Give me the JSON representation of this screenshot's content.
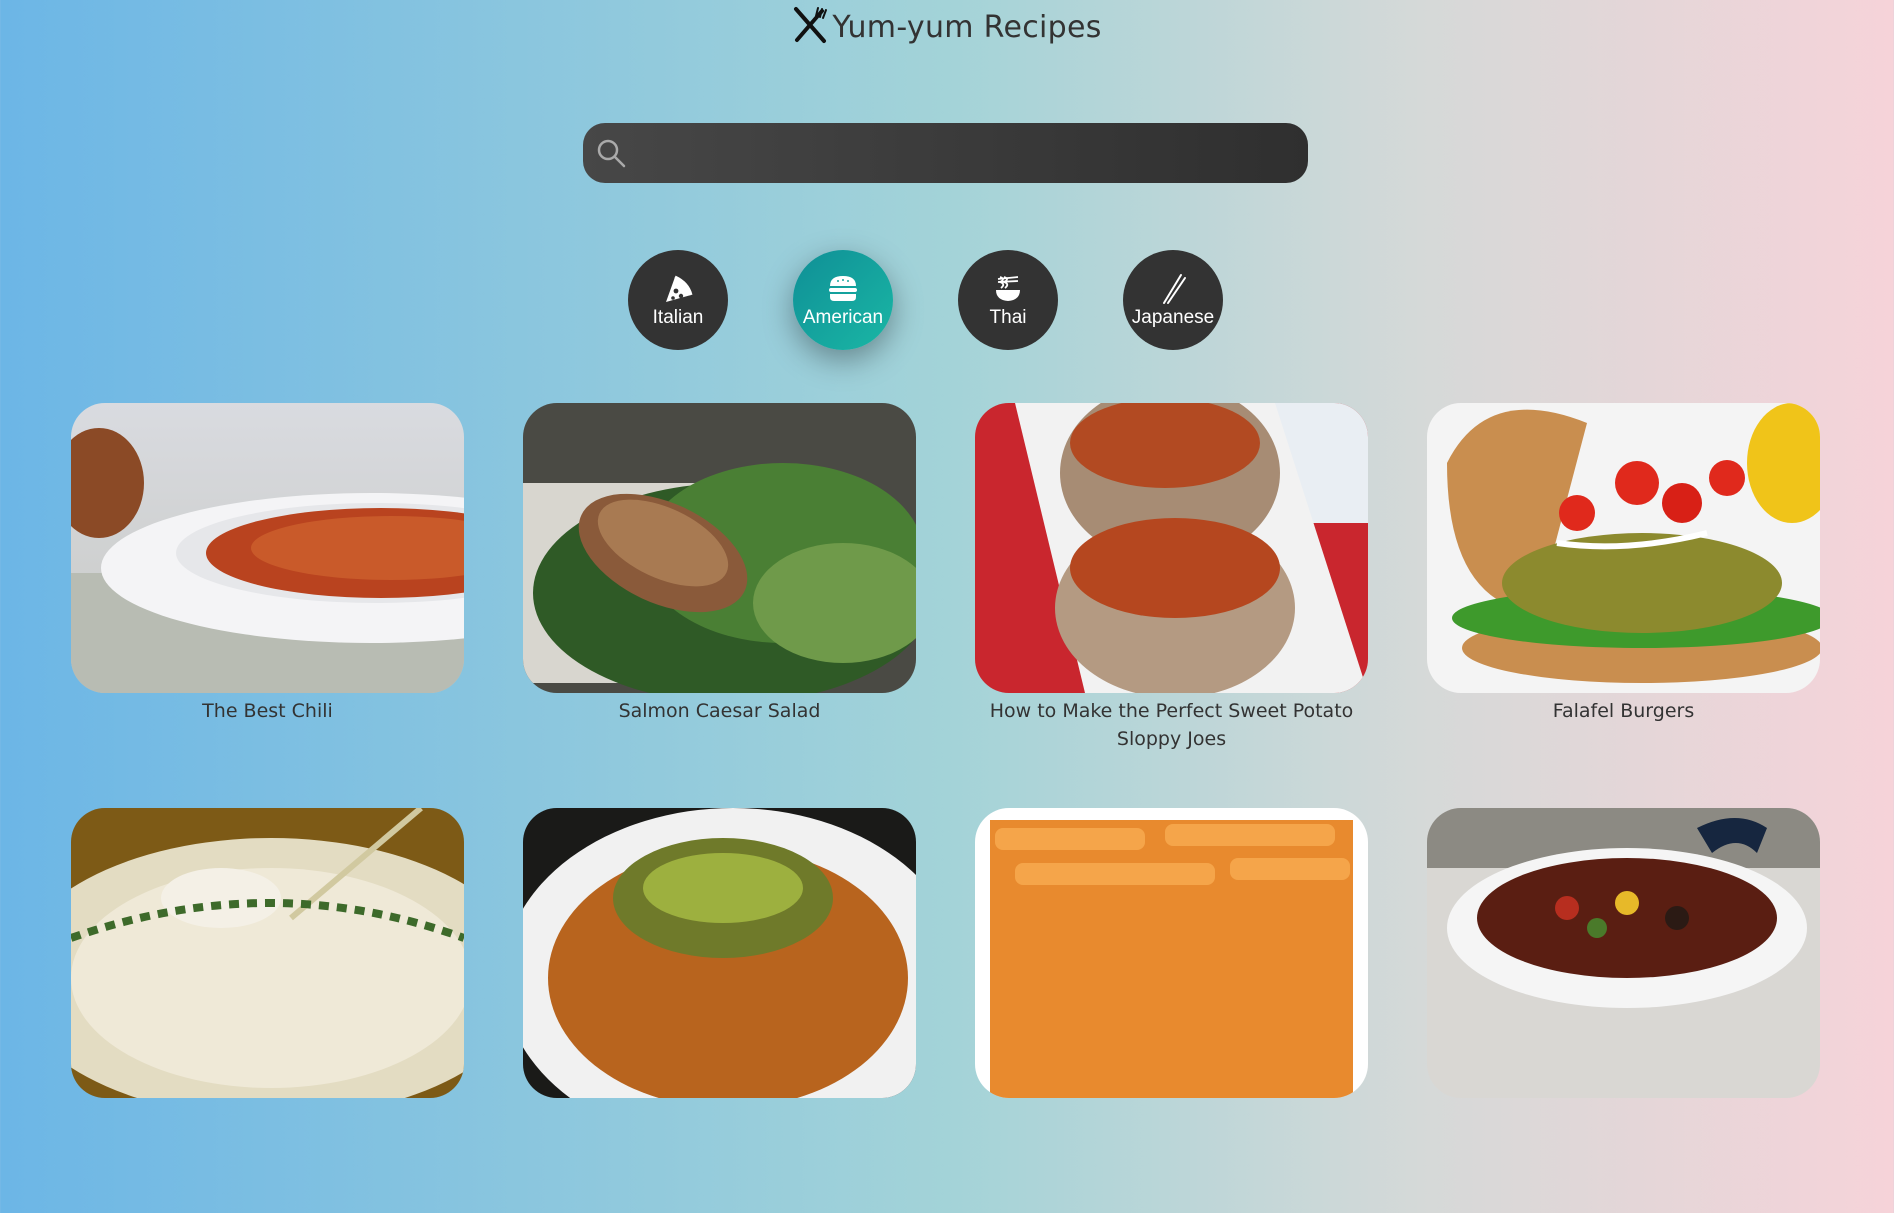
{
  "header": {
    "title": "Yum-yum Recipes",
    "logo_icon": "fork-knife-icon"
  },
  "search": {
    "placeholder": "",
    "value": "",
    "icon": "search-icon"
  },
  "categories": [
    {
      "label": "Italian",
      "icon": "pizza-icon",
      "active": false
    },
    {
      "label": "American",
      "icon": "burger-icon",
      "active": true
    },
    {
      "label": "Thai",
      "icon": "noodle-bowl-icon",
      "active": false
    },
    {
      "label": "Japanese",
      "icon": "chopsticks-icon",
      "active": false
    }
  ],
  "colors": {
    "accent": "#1aa7a0",
    "dark": "#333333"
  },
  "recipes": [
    {
      "title": "The Best Chili"
    },
    {
      "title": "Salmon Caesar Salad"
    },
    {
      "title": "How to Make the Perfect Sweet Potato Sloppy Joes"
    },
    {
      "title": "Falafel Burgers"
    },
    {
      "title": ""
    },
    {
      "title": ""
    },
    {
      "title": ""
    },
    {
      "title": ""
    }
  ]
}
